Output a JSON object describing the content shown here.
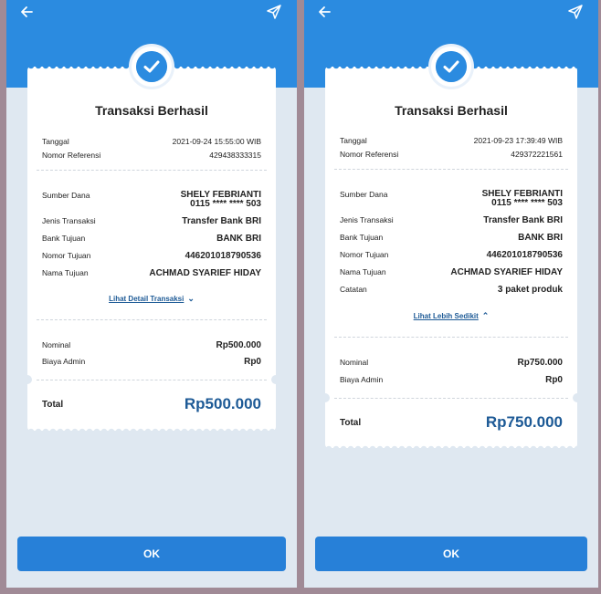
{
  "screens": [
    {
      "title": "Transaksi Berhasil",
      "tanggal_label": "Tanggal",
      "tanggal_value": "2021-09-24 15:55:00 WIB",
      "ref_label": "Nomor Referensi",
      "ref_value": "429438333315",
      "sumber_label": "Sumber Dana",
      "sumber_name": "SHELY FEBRIANTI",
      "sumber_account": "0115 **** **** 503",
      "jenis_label": "Jenis Transaksi",
      "jenis_value": "Transfer Bank BRI",
      "bank_label": "Bank Tujuan",
      "bank_value": "BANK BRI",
      "nomor_tujuan_label": "Nomor Tujuan",
      "nomor_tujuan_value": "446201018790536",
      "nama_tujuan_label": "Nama Tujuan",
      "nama_tujuan_value": "ACHMAD SYARIEF HIDAY",
      "link_label": "Lihat Detail Transaksi",
      "nominal_label": "Nominal",
      "nominal_value": "Rp500.000",
      "admin_label": "Biaya Admin",
      "admin_value": "Rp0",
      "total_label": "Total",
      "total_value": "Rp500.000",
      "ok_label": "OK"
    },
    {
      "title": "Transaksi Berhasil",
      "tanggal_label": "Tanggal",
      "tanggal_value": "2021-09-23 17:39:49 WIB",
      "ref_label": "Nomor Referensi",
      "ref_value": "429372221561",
      "sumber_label": "Sumber Dana",
      "sumber_name": "SHELY FEBRIANTI",
      "sumber_account": "0115 **** **** 503",
      "jenis_label": "Jenis Transaksi",
      "jenis_value": "Transfer Bank BRI",
      "bank_label": "Bank Tujuan",
      "bank_value": "BANK BRI",
      "nomor_tujuan_label": "Nomor Tujuan",
      "nomor_tujuan_value": "446201018790536",
      "nama_tujuan_label": "Nama Tujuan",
      "nama_tujuan_value": "ACHMAD SYARIEF HIDAY",
      "catatan_label": "Catatan",
      "catatan_value": "3 paket produk",
      "link_label": "Lihat Lebih Sedikit",
      "nominal_label": "Nominal",
      "nominal_value": "Rp750.000",
      "admin_label": "Biaya Admin",
      "admin_value": "Rp0",
      "total_label": "Total",
      "total_value": "Rp750.000",
      "ok_label": "OK"
    }
  ],
  "icons": {
    "back": "arrow-left-icon",
    "share": "send-icon",
    "success": "check-circle-icon",
    "expand": "chevron-down-icon",
    "collapse": "chevron-up-icon"
  },
  "colors": {
    "header_blue": "#2b8be0",
    "button_blue": "#2780d8",
    "total_blue": "#1d5a96",
    "background": "#dfe8f1"
  }
}
